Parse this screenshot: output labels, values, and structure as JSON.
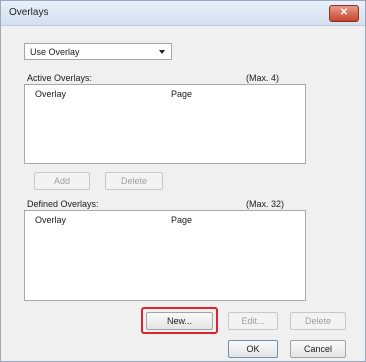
{
  "window": {
    "title": "Overlays",
    "close_glyph": "✕"
  },
  "mode_select": {
    "value": "Use Overlay"
  },
  "active": {
    "label": "Active Overlays:",
    "max": "(Max. 4)",
    "columns": [
      "Overlay",
      "Page"
    ]
  },
  "active_buttons": {
    "add": "Add",
    "delete": "Delete"
  },
  "defined": {
    "label": "Defined Overlays:",
    "max": "(Max. 32)",
    "columns": [
      "Overlay",
      "Page"
    ]
  },
  "defined_buttons": {
    "new": "New...",
    "edit": "Edit...",
    "delete": "Delete"
  },
  "footer": {
    "ok": "OK",
    "cancel": "Cancel"
  },
  "colors": {
    "highlight": "#d9262c",
    "close": "#c8432b"
  }
}
